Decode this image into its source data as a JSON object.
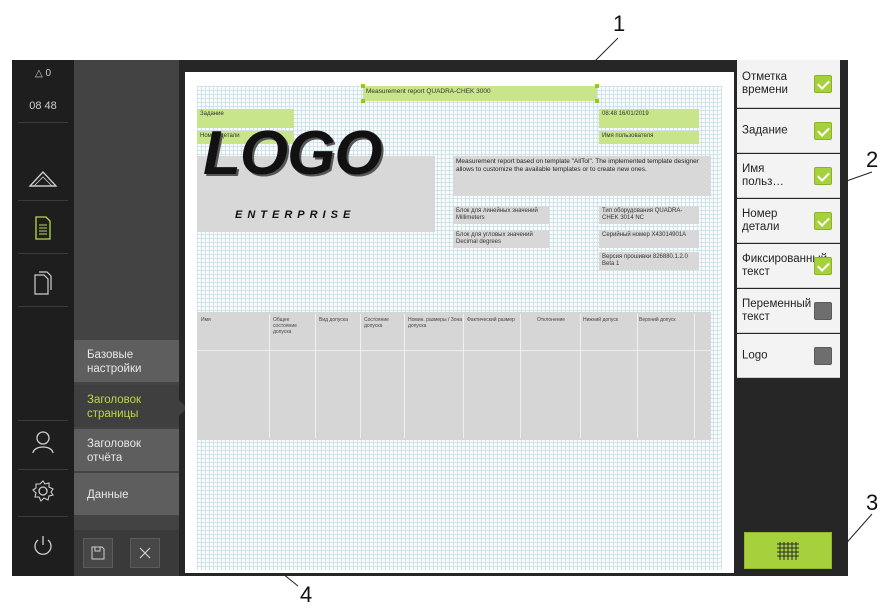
{
  "callouts": [
    "1",
    "2",
    "3",
    "4"
  ],
  "status": {
    "alerts": "0",
    "time": "08 48"
  },
  "submenu": {
    "items": [
      "Базовые настройки",
      "Заголовок страницы",
      "Заголовок отчёта",
      "Данные"
    ],
    "active_index": 1
  },
  "preview": {
    "report_title": "Measurement report QUADRA-CHEK 3000",
    "task_label": "Задание",
    "part_number_label": "Номер детали",
    "datetime": "08:48 16/01/2019",
    "user_label": "Имя пользователя",
    "logo_text": "LOGO",
    "logo_sub": "ENTERPRISE",
    "description": "Measurement report based on template \"AllTol\". The implemented template designer allows to customize the available templates or to create new ones.",
    "linear_block": "Блок для линейных значений Millimeters",
    "angular_block": "Блок для угловых значений Decimal degrees",
    "device_type": "Тип оборудования QUADRA-CHEK 3014 NC",
    "serial": "Серийный номер X43014901A",
    "firmware": "Версия прошивки 826880.1.2.0 Beta 1",
    "table_headers": [
      "Имя",
      "Общее состояние допуска",
      "Вид допуска",
      "Состояние допуска",
      "Номин. размеры / Зона допуска",
      "Фактический размер",
      "Отклонение",
      "Нижний допуск",
      "Верхний допуск"
    ]
  },
  "right_panel": {
    "items": [
      {
        "label": "Отметка времени",
        "checked": true
      },
      {
        "label": "Задание",
        "checked": true
      },
      {
        "label": "Имя польз…",
        "checked": true
      },
      {
        "label": "Номер детали",
        "checked": true
      },
      {
        "label": "Фиксированный текст",
        "checked": true
      },
      {
        "label": "Переменный текст",
        "checked": false
      },
      {
        "label": "Logo",
        "checked": false
      }
    ]
  },
  "icons": {
    "status_alert": "triangle-icon",
    "measure": "measure-icon",
    "report": "report-icon",
    "templates": "documents-icon",
    "user": "user-icon",
    "settings": "gear-icon",
    "power": "power-icon",
    "save": "save-icon",
    "close": "close-icon",
    "grid": "grid-icon"
  },
  "colors": {
    "accent": "#a7d13c",
    "active_text": "#b9d94a",
    "background": "#262626"
  }
}
